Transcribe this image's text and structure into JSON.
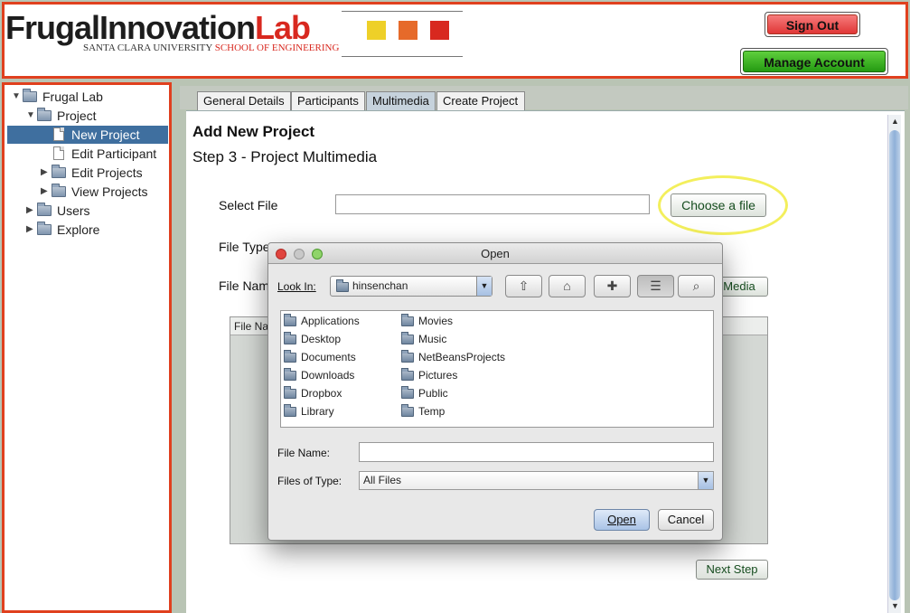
{
  "header": {
    "logo_text": "FrugalInnovation",
    "logo_text_accent": "Lab",
    "logo_subtitle": "SANTA CLARA UNIVERSITY",
    "logo_subtitle_accent": "SCHOOL OF ENGINEERING",
    "logo_colors": [
      "#eed028",
      "#e66a2a",
      "#d8281f"
    ],
    "sign_out_label": "Sign Out",
    "manage_account_label": "Manage Account"
  },
  "sidebar": {
    "tree": [
      {
        "label": "Frugal Lab",
        "level": 0,
        "icon": "folder-icon",
        "expanded": true
      },
      {
        "label": "Project",
        "level": 1,
        "icon": "folder-icon",
        "expanded": true
      },
      {
        "label": "New Project",
        "level": 2,
        "icon": "document-icon",
        "selected": true
      },
      {
        "label": "Edit Participant",
        "level": 2,
        "icon": "document-icon"
      },
      {
        "label": "Edit Projects",
        "level": 2,
        "icon": "folder-icon",
        "expanded": false
      },
      {
        "label": "View Projects",
        "level": 2,
        "icon": "folder-icon",
        "expanded": false
      },
      {
        "label": "Users",
        "level": 1,
        "icon": "folder-icon",
        "expanded": false
      },
      {
        "label": "Explore",
        "level": 1,
        "icon": "folder-icon",
        "expanded": false
      }
    ]
  },
  "tabs": [
    "General Details",
    "Participants",
    "Multimedia",
    "Create Project"
  ],
  "active_tab": "Multimedia",
  "main": {
    "heading": "Add New Project",
    "subheading": "Step 3 - Project Multimedia",
    "select_file_label": "Select File",
    "select_file_value": "",
    "choose_file_label": "Choose a file",
    "file_type_label": "File Type",
    "file_name_label": "File Nam",
    "add_media_label": "Media",
    "table_header": "File Na",
    "next_step_label": "Next Step"
  },
  "dialog": {
    "title": "Open",
    "look_in_label": "Look In:",
    "look_in_value": "hinsenchan",
    "toolbar_icons": [
      "up-folder-icon",
      "home-icon",
      "new-folder-icon",
      "list-view-icon",
      "details-view-icon"
    ],
    "files_col1": [
      "Applications",
      "Desktop",
      "Documents",
      "Downloads",
      "Dropbox",
      "Library"
    ],
    "files_col2": [
      "Movies",
      "Music",
      "NetBeansProjects",
      "Pictures",
      "Public",
      "Temp"
    ],
    "file_name_label": "File Name:",
    "file_name_value": "",
    "files_of_type_label": "Files of Type:",
    "files_of_type_value": "All Files",
    "open_label": "Open",
    "cancel_label": "Cancel"
  }
}
